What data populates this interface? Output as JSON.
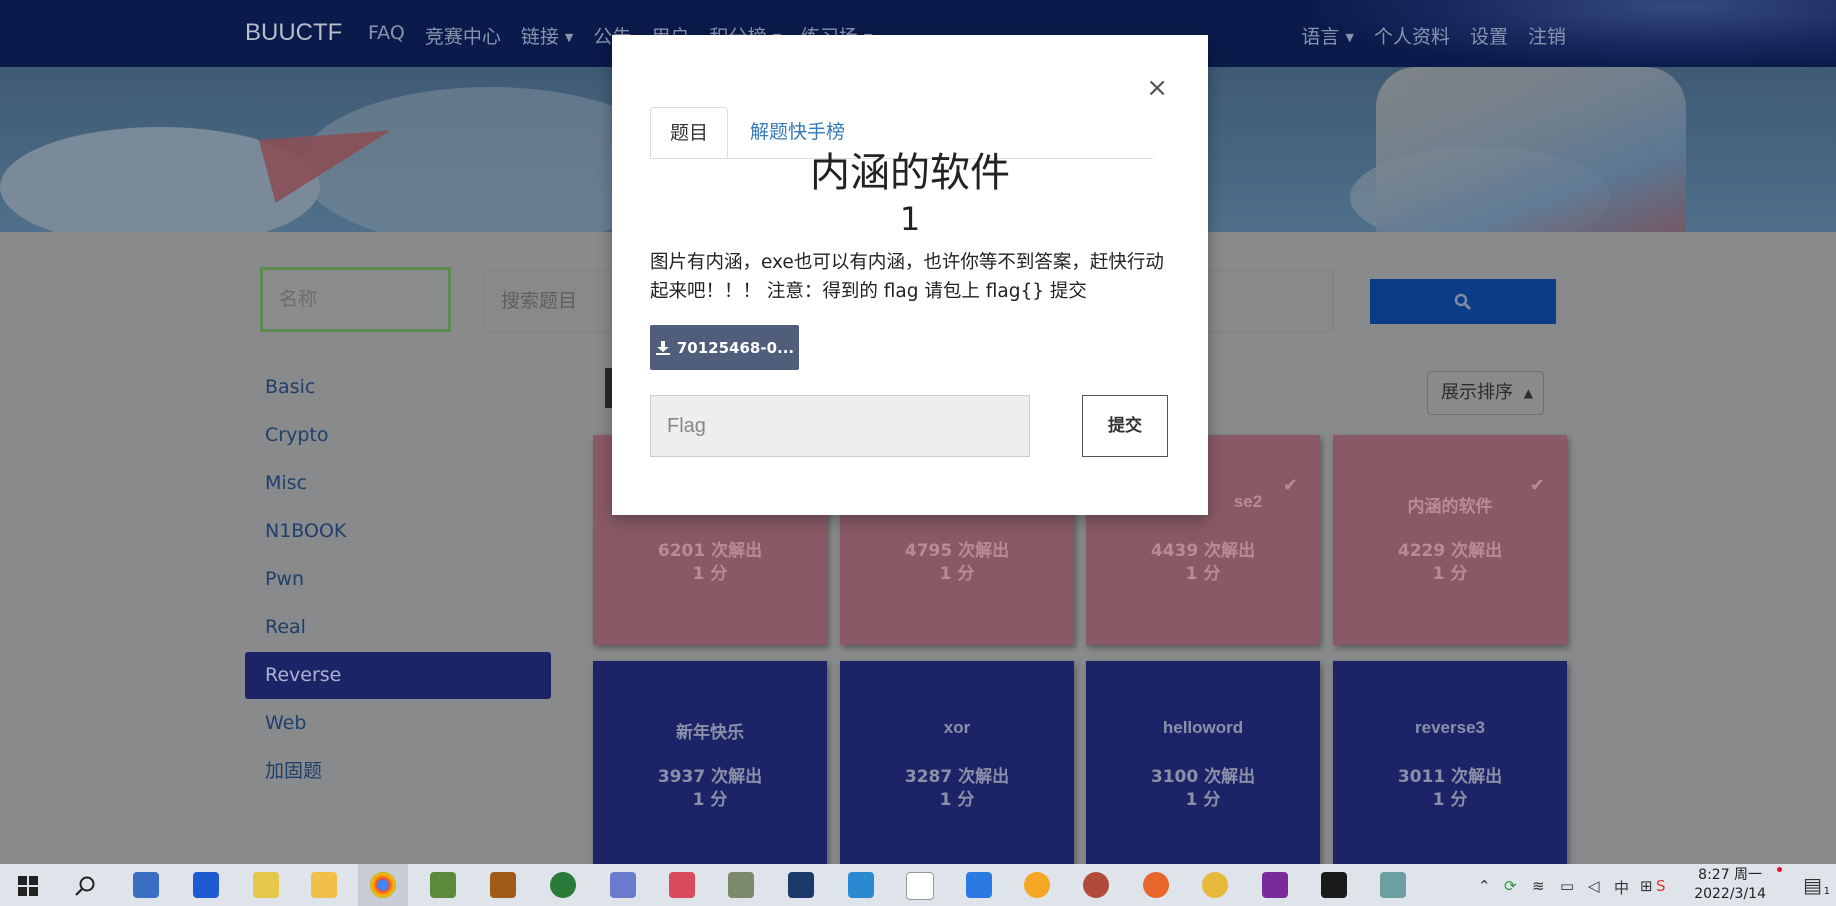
{
  "navbar": {
    "brand": "BUUCTF",
    "left_links": [
      "FAQ",
      "竞赛中心",
      "链接",
      "公告",
      "用户",
      "积分榜",
      "练习场"
    ],
    "right_links": [
      "语言",
      "个人资料",
      "设置",
      "注销"
    ]
  },
  "search": {
    "name_placeholder": "名称",
    "query_placeholder": "搜索题目"
  },
  "sidebar": {
    "items": [
      {
        "label": "Basic"
      },
      {
        "label": "Crypto"
      },
      {
        "label": "Misc"
      },
      {
        "label": "N1BOOK"
      },
      {
        "label": "Pwn"
      },
      {
        "label": "Real"
      },
      {
        "label": "Reverse",
        "active": true
      },
      {
        "label": "Web"
      },
      {
        "label": "加固题"
      }
    ]
  },
  "sort": {
    "label": "展示排序"
  },
  "cards": [
    {
      "title": "",
      "solves": "6201 次解出",
      "points": "1 分",
      "solved": true
    },
    {
      "title": "",
      "solves": "4795 次解出",
      "points": "1 分",
      "solved": true
    },
    {
      "title": "se2",
      "solves": "4439 次解出",
      "points": "1 分",
      "solved": true
    },
    {
      "title": "内涵的软件",
      "solves": "4229 次解出",
      "points": "1 分",
      "solved": true
    },
    {
      "title": "新年快乐",
      "solves": "3937 次解出",
      "points": "1 分",
      "solved": false
    },
    {
      "title": "xor",
      "solves": "3287 次解出",
      "points": "1 分",
      "solved": false
    },
    {
      "title": "helloword",
      "solves": "3100 次解出",
      "points": "1 分",
      "solved": false
    },
    {
      "title": "reverse3",
      "solves": "3011 次解出",
      "points": "1 分",
      "solved": false
    }
  ],
  "modal": {
    "tabs": [
      "题目",
      "解题快手榜"
    ],
    "close": "×",
    "title": "内涵的软件",
    "points": "1",
    "description": "图片有内涵，exe也可以有内涵，也许你等不到答案，赶快行动起来吧！！！ 注意：得到的 flag 请包上 flag{} 提交",
    "download_label": "70125468-0...",
    "flag_placeholder": "Flag",
    "submit_label": "提交"
  },
  "taskbar": {
    "time": "8:27 周一",
    "date": "2022/3/14",
    "ime": "中",
    "notification_count": "1"
  },
  "colors": {
    "navbar": "#0a1a4a",
    "solved_card": "#895a66",
    "unsolved_card": "#1c2467",
    "search_button": "#0b3c87",
    "download_button": "#4f5e7b"
  }
}
